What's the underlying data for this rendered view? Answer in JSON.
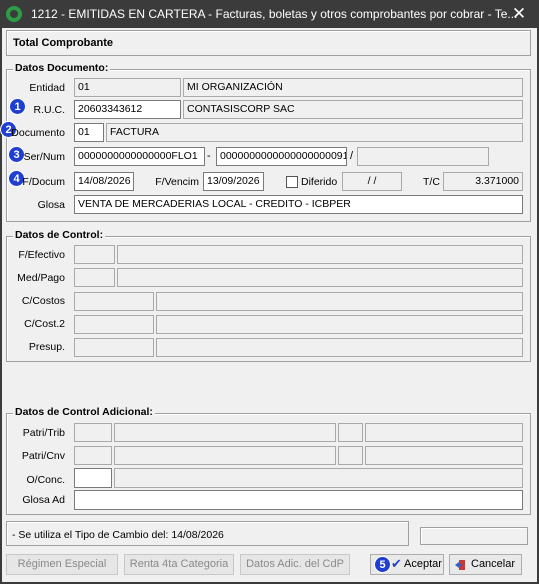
{
  "window": {
    "title": "1212 - EMITIDAS EN CARTERA - Facturas, boletas y otros comprobantes por cobrar - Te...",
    "close_glyph": "✕"
  },
  "total_comprobante": "Total Comprobante",
  "datos_documento": {
    "title": "Datos Documento:",
    "entidad_label": "Entidad",
    "entidad_code": "01",
    "entidad_name": "MI ORGANIZACIÓN",
    "ruc_label": "R.U.C.",
    "ruc_value": "20603343612",
    "ruc_name": "CONTASISCORP SAC",
    "documento_label": "Documento",
    "documento_code": "01",
    "documento_name": "FACTURA",
    "sernum_label": "Ser/Num",
    "serie": "0000000000000000FLO1",
    "numero": "0000000000000000000091",
    "dash": "-",
    "slash": "/",
    "fdocum_label": "F/Docum",
    "fdocum_value": "14/08/2026",
    "fvencim_label": "F/Vencim",
    "fvencim_value": "13/09/2026",
    "diferido_label": "Diferido",
    "diferido_value": "/ /",
    "tc_label": "T/C",
    "tc_value": "3.371000",
    "glosa_label": "Glosa",
    "glosa_value": "VENTA DE MERCADERIAS LOCAL - CREDITO - ICBPER"
  },
  "datos_control": {
    "title": "Datos de Control:",
    "fefectivo_label": "F/Efectivo",
    "medpago_label": "Med/Pago",
    "ccostos_label": "C/Costos",
    "ccost2_label": "C/Cost.2",
    "presup_label": "Presup."
  },
  "datos_control_adicional": {
    "title": "Datos de Control Adicional:",
    "patritrib_label": "Patri/Trib",
    "patricnv_label": "Patri/Cnv",
    "oconc_label": "O/Conc.",
    "glosaad_label": "Glosa Ad"
  },
  "status": {
    "message": "- Se utiliza el Tipo de Cambio del: 14/08/2026"
  },
  "buttons": {
    "regimen": "Régimen Especial",
    "renta": "Renta 4ta Categoria",
    "datos_adic": "Datos Adic. del CdP",
    "aceptar": "Aceptar",
    "cancelar": "Cancelar"
  },
  "badges": [
    "1",
    "2",
    "3",
    "4",
    "5"
  ],
  "colors": {
    "badge": "#1f3fd1",
    "titlebar": "#3b3b3b",
    "window_bg": "#f0f0f0"
  }
}
